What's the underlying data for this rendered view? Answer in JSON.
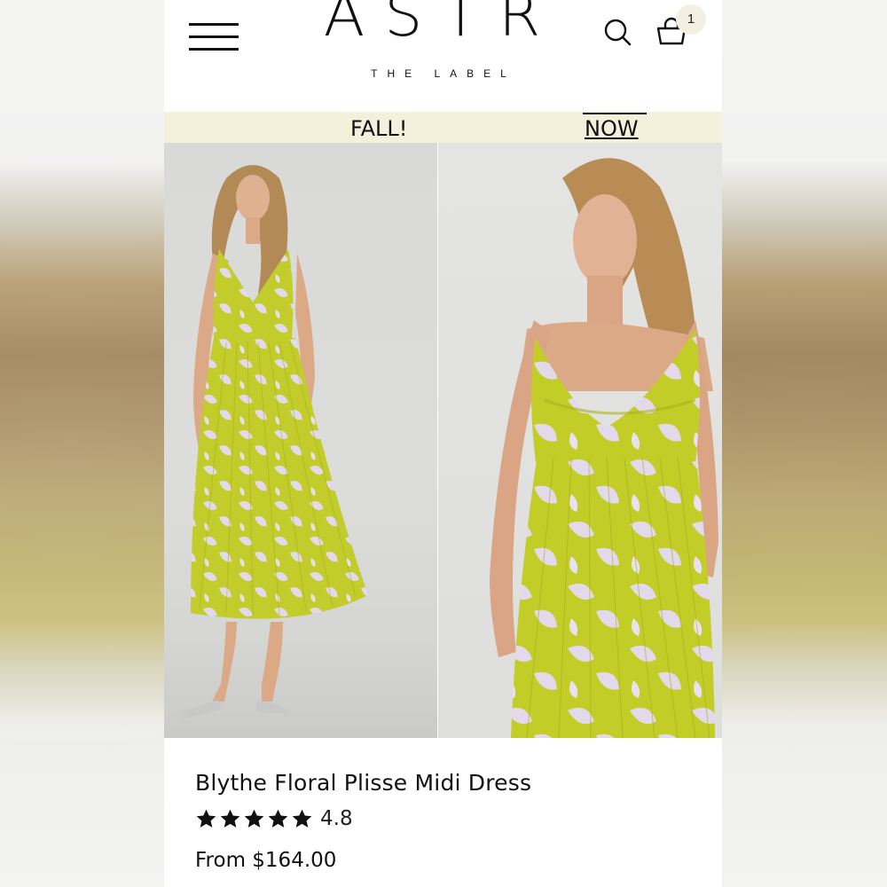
{
  "header": {
    "logo": "ASTR",
    "logo_sub": "THE LABEL",
    "cart_count": "1",
    "icons": [
      "menu-icon",
      "search-icon",
      "shopping-bag-icon"
    ]
  },
  "promo": {
    "left_text": "FALL!",
    "right_link": "NOW"
  },
  "gallery": {
    "images": [
      "model-full-length-photo",
      "model-closeup-photo"
    ]
  },
  "product": {
    "name": "Blythe Floral Plisse Midi Dress",
    "rating": "4.8",
    "stars_filled": 5,
    "stars_total": 5,
    "price": "From $164.00"
  },
  "colors": {
    "promo_bg": "#f5f0dc",
    "dress_green": "#c2cc2a",
    "dress_lilac": "#e3d9ea"
  }
}
